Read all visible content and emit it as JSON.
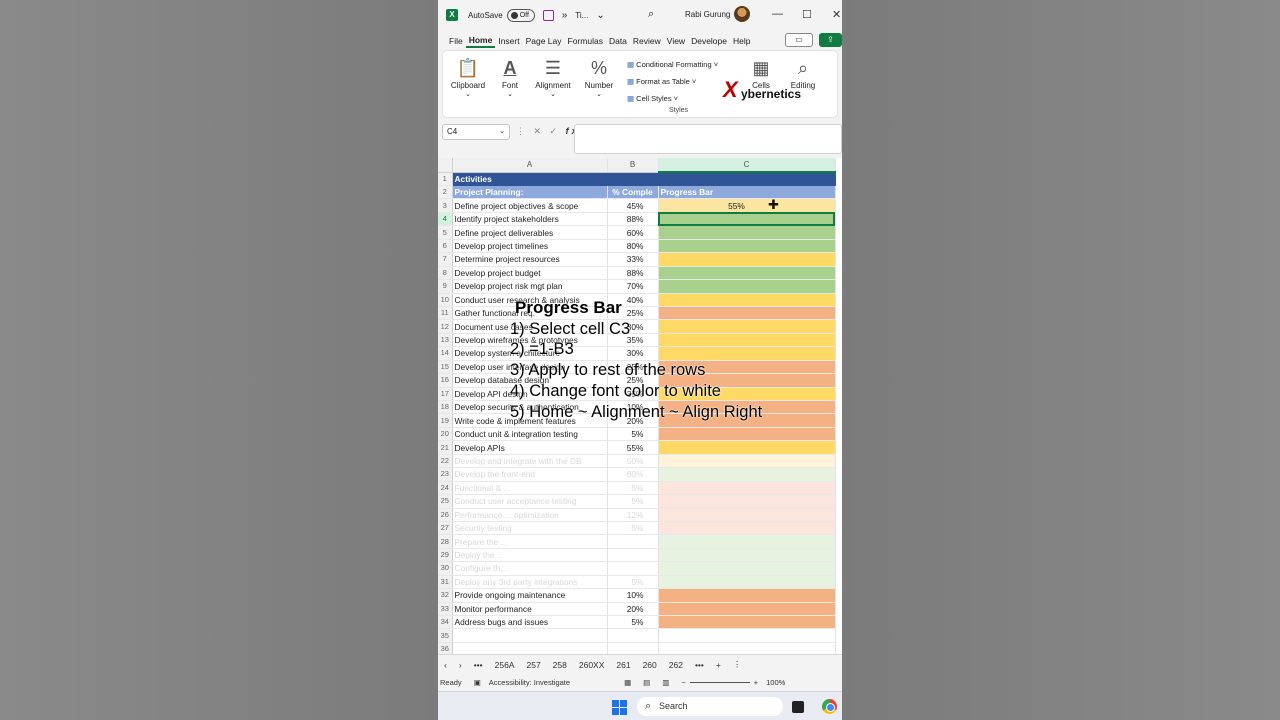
{
  "titlebar": {
    "autosave_label": "AutoSave",
    "autosave_state": "Off",
    "filename": "Ti...",
    "user": "Rabi Gurung",
    "more": "»"
  },
  "menu": [
    "File",
    "Home",
    "Insert",
    "Page Lay",
    "Formulas",
    "Data",
    "Review",
    "View",
    "Develope",
    "Help"
  ],
  "ribbon": {
    "clipboard": "Clipboard",
    "font": "Font",
    "alignment": "Alignment",
    "number": "Number",
    "cond_format": "Conditional Formatting ˅",
    "format_table": "Format as Table ˅",
    "cell_styles": "Cell Styles ˅",
    "styles": "Styles",
    "cells": "Cells",
    "editing": "Editing"
  },
  "brand": {
    "x": "X",
    "rest": "ybernetics"
  },
  "formula_bar": {
    "name_box": "C4",
    "fx": "fx"
  },
  "columns": [
    "A",
    "B",
    "C"
  ],
  "rows": [
    {
      "n": "1",
      "a": "Activities",
      "b": "",
      "c": "",
      "color": "#2f5597"
    },
    {
      "n": "2",
      "a": "Project Planning:",
      "b": "% Comple",
      "c": "Progress Bar",
      "color": "#8ea9db"
    },
    {
      "n": "3",
      "a": "Define project objectives & scope",
      "b": "45%",
      "c": "55%",
      "color": "#fbe5a0"
    },
    {
      "n": "4",
      "a": "Identify project stakeholders",
      "b": "88%",
      "c": "",
      "color": "#a9d18e"
    },
    {
      "n": "5",
      "a": "Define project deliverables",
      "b": "60%",
      "c": "",
      "color": "#a9d18e"
    },
    {
      "n": "6",
      "a": "Develop project timelines",
      "b": "80%",
      "c": "",
      "color": "#a9d18e"
    },
    {
      "n": "7",
      "a": "Determine project resources",
      "b": "33%",
      "c": "",
      "color": "#ffd966"
    },
    {
      "n": "8",
      "a": "Develop project budget",
      "b": "88%",
      "c": "",
      "color": "#a9d18e"
    },
    {
      "n": "9",
      "a": "Develop project risk mgt plan",
      "b": "70%",
      "c": "",
      "color": "#a9d18e"
    },
    {
      "n": "10",
      "a": "Conduct user research & analysis",
      "b": "40%",
      "c": "",
      "color": "#ffd966"
    },
    {
      "n": "11",
      "a": "Gather functional req.",
      "b": "25%",
      "c": "",
      "color": "#f4b183"
    },
    {
      "n": "12",
      "a": "Document use cases",
      "b": "30%",
      "c": "",
      "color": "#ffd966"
    },
    {
      "n": "13",
      "a": "Develop wireframes & prototypes",
      "b": "35%",
      "c": "",
      "color": "#ffd966"
    },
    {
      "n": "14",
      "a": "Develop system architecture",
      "b": "30%",
      "c": "",
      "color": "#ffd966"
    },
    {
      "n": "15",
      "a": "Develop user interface design",
      "b": "25%",
      "c": "",
      "color": "#f4b183"
    },
    {
      "n": "16",
      "a": "Develop database design",
      "b": "25%",
      "c": "",
      "color": "#f4b183"
    },
    {
      "n": "17",
      "a": "Develop API design",
      "b": "35%",
      "c": "",
      "color": "#ffd966"
    },
    {
      "n": "18",
      "a": "Develop security & authentication",
      "b": "10%",
      "c": "",
      "color": "#f4b183"
    },
    {
      "n": "19",
      "a": "Write code & implement features",
      "b": "20%",
      "c": "",
      "color": "#f4b183"
    },
    {
      "n": "20",
      "a": "Conduct unit & integration testing",
      "b": "5%",
      "c": "",
      "color": "#f4b183"
    },
    {
      "n": "21",
      "a": "Develop APIs",
      "b": "55%",
      "c": "",
      "color": "#ffd966"
    },
    {
      "n": "22",
      "a": "Develop and integrate with the DB",
      "b": "50%",
      "c": "",
      "color": "#fdf3da",
      "faded": true
    },
    {
      "n": "23",
      "a": "Develop the front-end",
      "b": "60%",
      "c": "",
      "color": "#e7f3e0",
      "faded": true
    },
    {
      "n": "24",
      "a": "Functional & ...",
      "b": "5%",
      "c": "",
      "color": "#fbe5dc",
      "faded": true
    },
    {
      "n": "25",
      "a": "Conduct user acceptance testing",
      "b": "5%",
      "c": "",
      "color": "#fbe5dc",
      "faded": true
    },
    {
      "n": "26",
      "a": "Performance ... optimization",
      "b": "12%",
      "c": "",
      "color": "#fbe5dc",
      "faded": true
    },
    {
      "n": "27",
      "a": "Security testing",
      "b": "5%",
      "c": "",
      "color": "#fbe5dc",
      "faded": true
    },
    {
      "n": "28",
      "a": "Prepare the ...",
      "b": "",
      "c": "",
      "color": "#e7f3e0",
      "faded": true
    },
    {
      "n": "29",
      "a": "Deploy the ...",
      "b": "",
      "c": "",
      "color": "#e7f3e0",
      "faded": true
    },
    {
      "n": "30",
      "a": "Configure th...",
      "b": "",
      "c": "",
      "color": "#e7f3e0",
      "faded": true
    },
    {
      "n": "31",
      "a": "Deploy any 3rd party integrations",
      "b": "5%",
      "c": "",
      "color": "#e7f3e0",
      "faded": true
    },
    {
      "n": "32",
      "a": "Provide ongoing maintenance",
      "b": "10%",
      "c": "",
      "color": "#f4b183"
    },
    {
      "n": "33",
      "a": "Monitor performance",
      "b": "20%",
      "c": "",
      "color": "#f4b183"
    },
    {
      "n": "34",
      "a": "Address bugs and issues",
      "b": "5%",
      "c": "",
      "color": "#f4b183"
    },
    {
      "n": "35",
      "a": "",
      "b": "",
      "c": "",
      "color": ""
    },
    {
      "n": "36",
      "a": "",
      "b": "",
      "c": "",
      "color": ""
    }
  ],
  "overlay": {
    "title": "Progress Bar",
    "steps": [
      "1) Select cell C3",
      "2) =1-B3",
      "3) Apply to rest of the rows",
      "4) Change font color to white",
      "5) Home ~ Alignment ~ Align Right"
    ]
  },
  "sheet_tabs": [
    "256A",
    "257",
    "258",
    "260XX",
    "261",
    "260",
    "262"
  ],
  "status": {
    "ready": "Ready",
    "accessibility": "Accessibility: Investigate",
    "zoom": "100%"
  },
  "taskbar": {
    "search": "Search"
  }
}
